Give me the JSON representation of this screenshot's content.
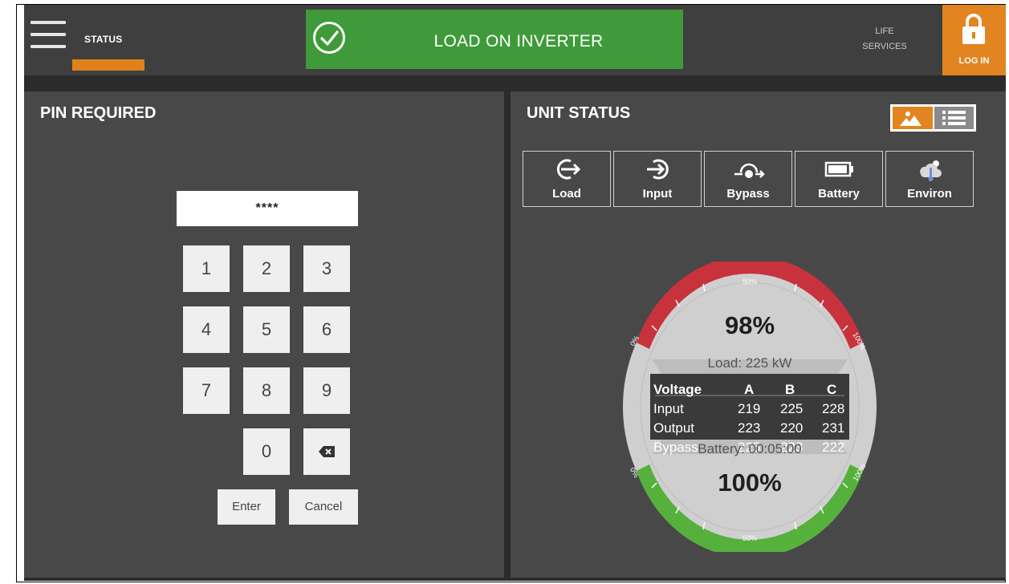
{
  "header": {
    "status_tab": "STATUS",
    "alarm_banner": "LOAD ON INVERTER",
    "life_services_line1": "LIFE",
    "life_services_line2": "SERVICES",
    "login_label": "LOG IN"
  },
  "colors": {
    "accent_orange": "#e2841f",
    "status_green": "#3f9b3a",
    "gauge_red": "#c8323c",
    "gauge_green": "#56b03c"
  },
  "pin_panel": {
    "title": "PIN REQUIRED",
    "pin_value": "****",
    "keys": [
      "1",
      "2",
      "3",
      "4",
      "5",
      "6",
      "7",
      "8",
      "9",
      "0"
    ],
    "enter_label": "Enter",
    "cancel_label": "Cancel"
  },
  "status_panel": {
    "title": "UNIT STATUS",
    "tabs": [
      {
        "label": "Load",
        "icon": "load-icon"
      },
      {
        "label": "Input",
        "icon": "input-icon"
      },
      {
        "label": "Bypass",
        "icon": "bypass-icon"
      },
      {
        "label": "Battery",
        "icon": "battery-icon"
      },
      {
        "label": "Environ",
        "icon": "environ-icon"
      }
    ],
    "gauge": {
      "load_percent": "98%",
      "load_text": "Load: 225 kW",
      "battery_text": "Battery: 00:05:00",
      "battery_percent": "100%",
      "scale_mid": "50%",
      "scale_min": "0%",
      "scale_max": "100%",
      "readings_header": [
        "Voltage",
        "A",
        "B",
        "C"
      ],
      "readings": [
        {
          "label": "Input",
          "a": "219",
          "b": "225",
          "c": "228"
        },
        {
          "label": "Output",
          "a": "223",
          "b": "220",
          "c": "231"
        },
        {
          "label": "Bypass",
          "a": "225",
          "b": "223",
          "c": "222"
        }
      ]
    }
  }
}
